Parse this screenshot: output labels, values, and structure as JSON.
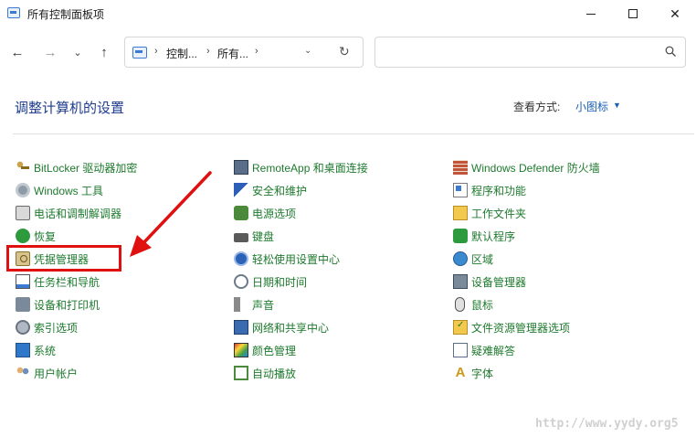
{
  "window": {
    "title": "所有控制面板项",
    "min_glyph": "",
    "close_glyph": "✕"
  },
  "nav": {
    "back": "←",
    "forward": "→",
    "recent": "⌄",
    "up": "↑",
    "breadcrumb": [
      "控制...",
      "所有..."
    ],
    "sep": "›",
    "dropdown": "⌄",
    "refresh": "↻",
    "search_placeholder": ""
  },
  "header": {
    "title": "调整计算机的设置",
    "view_by_label": "查看方式:",
    "view_by_value": "小图标",
    "caret": "▼"
  },
  "columns": [
    [
      {
        "label": "BitLocker 驱动器加密",
        "icon": "bitlocker-key-icon"
      },
      {
        "label": "Windows 工具",
        "icon": "windows-tools-icon"
      },
      {
        "label": "电话和调制解调器",
        "icon": "phone-modem-icon"
      },
      {
        "label": "恢复",
        "icon": "recovery-icon"
      },
      {
        "label": "凭据管理器",
        "icon": "credential-manager-icon"
      },
      {
        "label": "任务栏和导航",
        "icon": "taskbar-icon"
      },
      {
        "label": "设备和打印机",
        "icon": "printer-icon"
      },
      {
        "label": "索引选项",
        "icon": "indexing-icon"
      },
      {
        "label": "系统",
        "icon": "system-icon"
      },
      {
        "label": "用户帐户",
        "icon": "user-accounts-icon"
      }
    ],
    [
      {
        "label": "RemoteApp 和桌面连接",
        "icon": "remoteapp-icon"
      },
      {
        "label": "安全和维护",
        "icon": "security-flag-icon"
      },
      {
        "label": "电源选项",
        "icon": "power-options-icon"
      },
      {
        "label": "键盘",
        "icon": "keyboard-icon"
      },
      {
        "label": "轻松使用设置中心",
        "icon": "ease-of-access-icon"
      },
      {
        "label": "日期和时间",
        "icon": "clock-icon"
      },
      {
        "label": "声音",
        "icon": "speaker-icon"
      },
      {
        "label": "网络和共享中心",
        "icon": "network-icon"
      },
      {
        "label": "颜色管理",
        "icon": "color-management-icon"
      },
      {
        "label": "自动播放",
        "icon": "autoplay-icon"
      }
    ],
    [
      {
        "label": "Windows Defender 防火墙",
        "icon": "firewall-icon"
      },
      {
        "label": "程序和功能",
        "icon": "programs-icon"
      },
      {
        "label": "工作文件夹",
        "icon": "work-folders-icon"
      },
      {
        "label": "默认程序",
        "icon": "default-programs-icon"
      },
      {
        "label": "区域",
        "icon": "region-globe-icon"
      },
      {
        "label": "设备管理器",
        "icon": "device-manager-icon"
      },
      {
        "label": "鼠标",
        "icon": "mouse-icon"
      },
      {
        "label": "文件资源管理器选项",
        "icon": "file-explorer-options-icon"
      },
      {
        "label": "疑难解答",
        "icon": "troubleshooting-icon"
      },
      {
        "label": "字体",
        "icon": "fonts-icon"
      }
    ]
  ],
  "annotation": {
    "highlighted_item": "凭据管理器",
    "color": "#e01010"
  },
  "watermark": "http://www.yydy.org5"
}
